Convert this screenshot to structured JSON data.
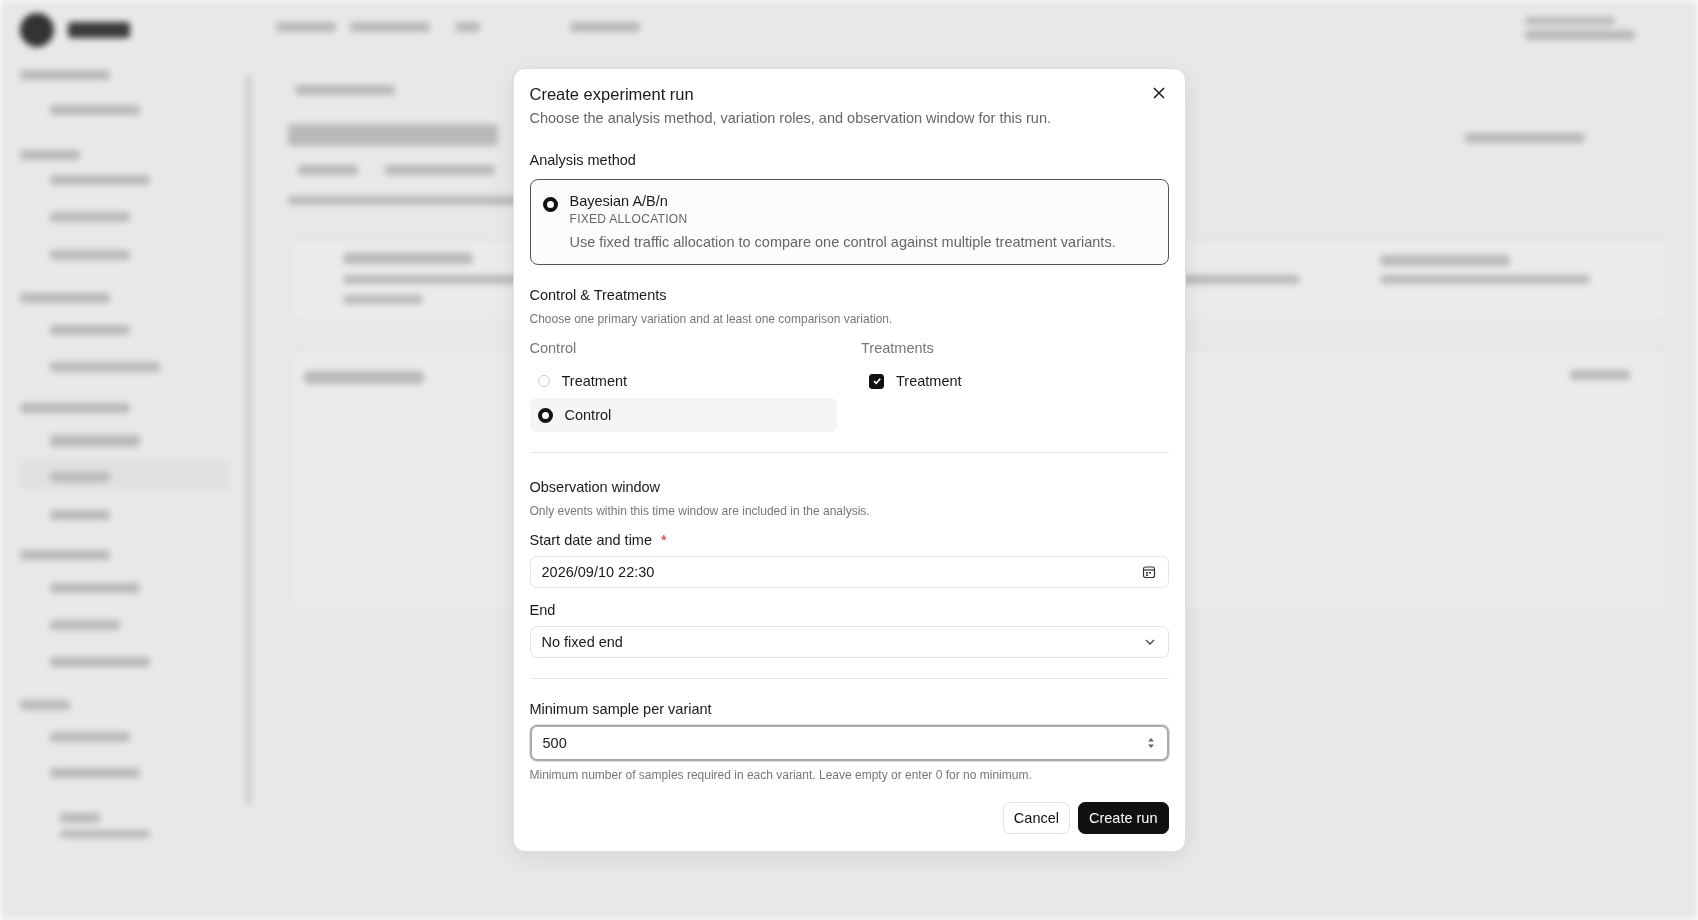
{
  "dialog": {
    "title": "Create experiment run",
    "subtitle": "Choose the analysis method, variation roles, and observation window for this run.",
    "analysis": {
      "label": "Analysis method",
      "options": [
        {
          "name": "Bayesian A/B/n",
          "tag": "FIXED ALLOCATION",
          "description": "Use fixed traffic allocation to compare one control against multiple treatment variants.",
          "selected": true
        }
      ]
    },
    "variations": {
      "label": "Control & Treatments",
      "hint": "Choose one primary variation and at least one comparison variation.",
      "control": {
        "label": "Control",
        "options": [
          {
            "label": "Treatment",
            "selected": false
          },
          {
            "label": "Control",
            "selected": true
          }
        ]
      },
      "treatments": {
        "label": "Treatments",
        "options": [
          {
            "label": "Treatment",
            "checked": true
          }
        ]
      }
    },
    "observation": {
      "label": "Observation window",
      "hint": "Only events within this time window are included in the analysis.",
      "start": {
        "label": "Start date and time",
        "required_mark": "*",
        "value": "2026/09/10 22:30"
      },
      "end": {
        "label": "End",
        "value": "No fixed end"
      }
    },
    "min_sample": {
      "label": "Minimum sample per variant",
      "value": "500",
      "hint": "Minimum number of samples required in each variant. Leave empty or enter 0 for no minimum."
    },
    "buttons": [
      {
        "label": "Cancel",
        "kind": "secondary"
      },
      {
        "label": "Create run",
        "kind": "primary"
      }
    ]
  }
}
